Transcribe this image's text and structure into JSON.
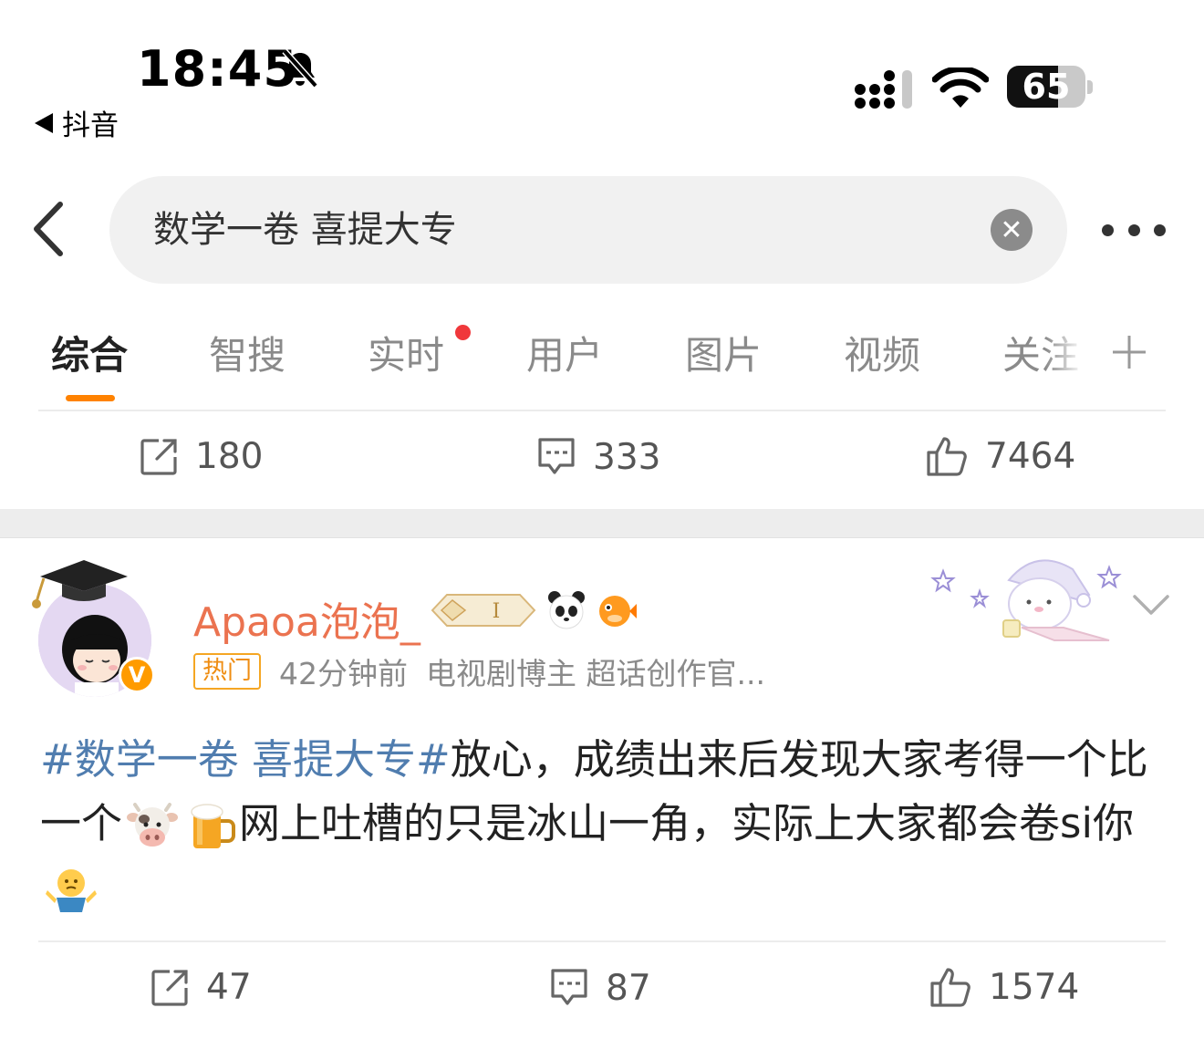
{
  "status_bar": {
    "time": "18:45",
    "back_app_label": "抖音",
    "battery_percent": 65,
    "battery_label": "65"
  },
  "search": {
    "query": "数学一卷 喜提大专"
  },
  "tabs": [
    {
      "label": "综合",
      "active": true
    },
    {
      "label": "智搜",
      "active": false
    },
    {
      "label": "实时",
      "active": false,
      "has_dot": true
    },
    {
      "label": "用户",
      "active": false
    },
    {
      "label": "图片",
      "active": false
    },
    {
      "label": "视频",
      "active": false
    },
    {
      "label": "关注",
      "active": false
    }
  ],
  "prev_post_actions": {
    "reposts": "180",
    "comments": "333",
    "likes": "7464"
  },
  "post": {
    "username": "Apaoa泡泡_",
    "hot_label": "热门",
    "time_ago": "42分钟前",
    "description": "电视剧博主 超话创作官...",
    "topic": "#数学一卷 喜提大专#",
    "text_1": "放心，成绩出来后发现大家考得一个比一个",
    "text_2": "网上吐槽的只是冰山一角，实际上大家都会卷si你",
    "verified_badge": "V",
    "actions": {
      "reposts": "47",
      "comments": "87",
      "likes": "1574"
    }
  },
  "colors": {
    "accent_orange": "#ff8200",
    "username": "#eb7350",
    "topic_link": "#507daf",
    "red_dot": "#f0383b"
  },
  "icons": [
    "bell-slash-icon",
    "signal-icon",
    "wifi-icon",
    "battery-icon",
    "back-chevron-icon",
    "clear-icon",
    "more-icon",
    "plus-icon",
    "repost-icon",
    "comment-icon",
    "like-icon",
    "cow-emoji",
    "beer-emoji",
    "shrug-emoji"
  ]
}
